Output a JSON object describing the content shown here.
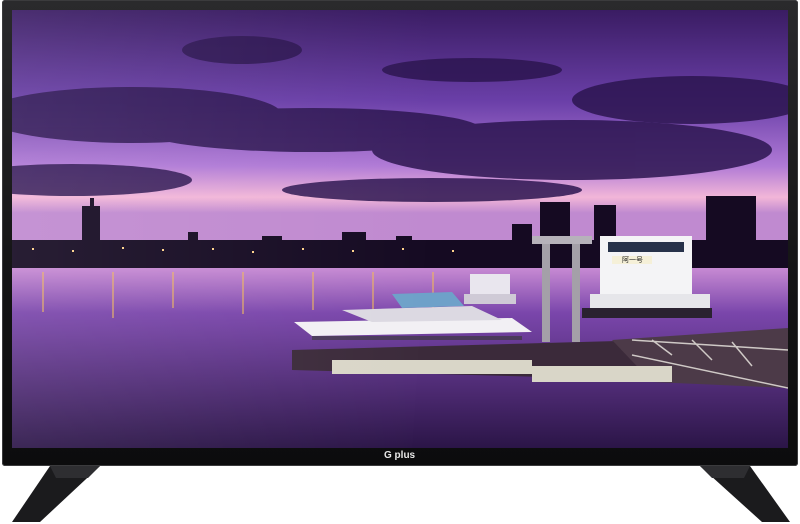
{
  "product": {
    "brand_logo": "G plus"
  },
  "screen_content": {
    "boat_sign_text": "阿一号"
  },
  "colors": {
    "bezel": "#161617",
    "sky_top": "#3a1c63",
    "sky_mid": "#9a6bd0",
    "horizon": "#f2b6d8",
    "water": "#2b1547"
  }
}
